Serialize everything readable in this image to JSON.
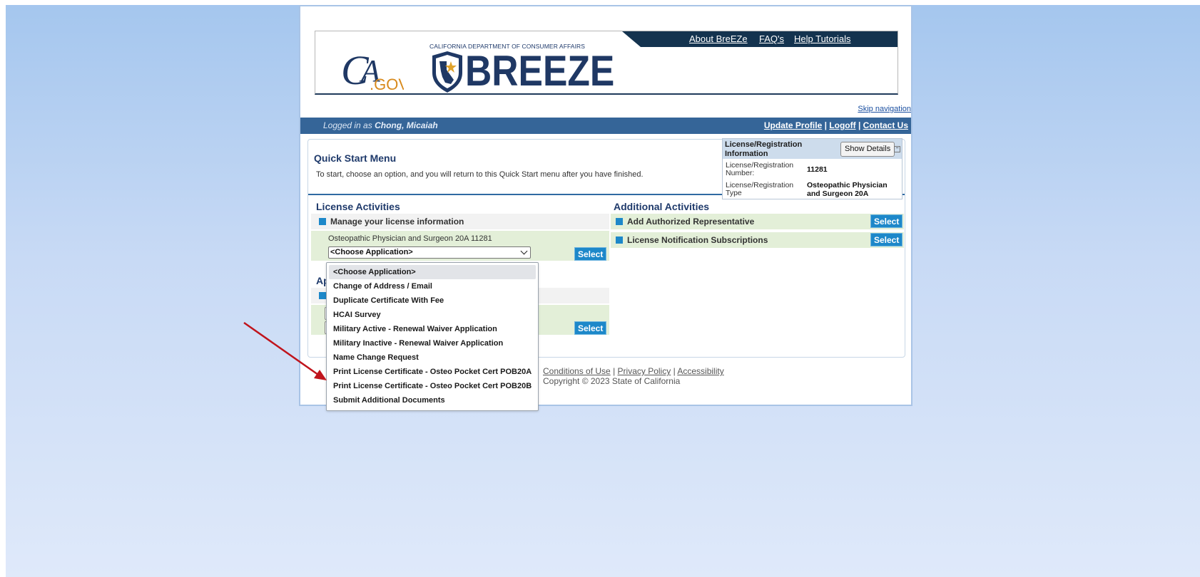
{
  "header": {
    "cagov_logo": "CA.GOV",
    "dept": "CALIFORNIA DEPARTMENT OF CONSUMER AFFAIRS",
    "brand": "BREEZE",
    "nav": [
      "About BreEZe",
      "FAQ's",
      "Help Tutorials"
    ],
    "skip_nav": "Skip navigation"
  },
  "userbar": {
    "logged_in_prefix": "Logged in as",
    "user_name": "Chong, Micaiah",
    "links": [
      "Update Profile",
      "Logoff",
      "Contact Us"
    ],
    "separator": "|"
  },
  "quick_start": {
    "title": "Quick Start Menu",
    "description": "To start, choose an option, and you will return to this Quick Start menu after you have finished."
  },
  "license_info": {
    "title": "License/Registration Information",
    "show_details": "Show Details",
    "collapse_icon": "minus-icon",
    "number_label": "License/Registration Number:",
    "number_value": "11281",
    "type_label": "License/Registration Type",
    "type_value": "Osteopathic Physician and Surgeon 20A"
  },
  "license_activities": {
    "title": "License Activities",
    "manage_label": "Manage your license information",
    "license_line": "Osteopathic Physician and Surgeon 20A  11281",
    "chooser_value": "<Choose Application>",
    "select_label": "Select"
  },
  "applications": {
    "title_fragment": "Ap",
    "select_label": "Select"
  },
  "additional_activities": {
    "title": "Additional Activities",
    "items": [
      {
        "label": "Add Authorized Representative",
        "button": "Select"
      },
      {
        "label": "License Notification Subscriptions",
        "button": "Select"
      }
    ]
  },
  "footer": {
    "links": [
      "Conditions of Use",
      "Privacy Policy",
      "Accessibility"
    ],
    "copyright": "Copyright © 2023 State of California"
  },
  "dropdown": {
    "selected_index": 0,
    "options": [
      "<Choose Application>",
      "Change of Address / Email",
      "Duplicate Certificate With Fee",
      "HCAI Survey",
      "Military Active - Renewal Waiver Application",
      "Military Inactive - Renewal Waiver Application",
      "Name Change Request",
      "Print License Certificate - Osteo Pocket Cert POB20A",
      "Print License Certificate - Osteo Pocket Cert POB20B",
      "Submit Additional Documents"
    ]
  },
  "colors": {
    "brand_navy": "#1f3864",
    "accent_blue": "#1d88c9",
    "userbar": "#356598",
    "annotation_arrow": "#c0141c"
  }
}
